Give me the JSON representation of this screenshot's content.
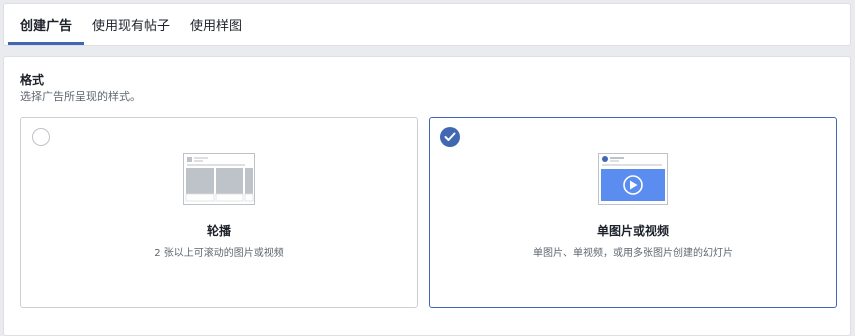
{
  "tabs": [
    {
      "label": "创建广告",
      "active": true
    },
    {
      "label": "使用现有帖子",
      "active": false
    },
    {
      "label": "使用样图",
      "active": false
    }
  ],
  "format": {
    "title": "格式",
    "subtitle": "选择广告所呈现的样式。",
    "options": [
      {
        "icon": "carousel-icon",
        "title": "轮播",
        "description": "2 张以上可滚动的图片或视频",
        "selected": false
      },
      {
        "icon": "single-image-video-icon",
        "title": "单图片或视频",
        "description": "单图片、单视频，或用多张图片创建的幻灯片",
        "selected": true
      }
    ]
  },
  "colors": {
    "accent": "#4267b2",
    "selected_border": "#4267b2",
    "border": "#ccd0d5",
    "secondary_text": "#606770"
  }
}
